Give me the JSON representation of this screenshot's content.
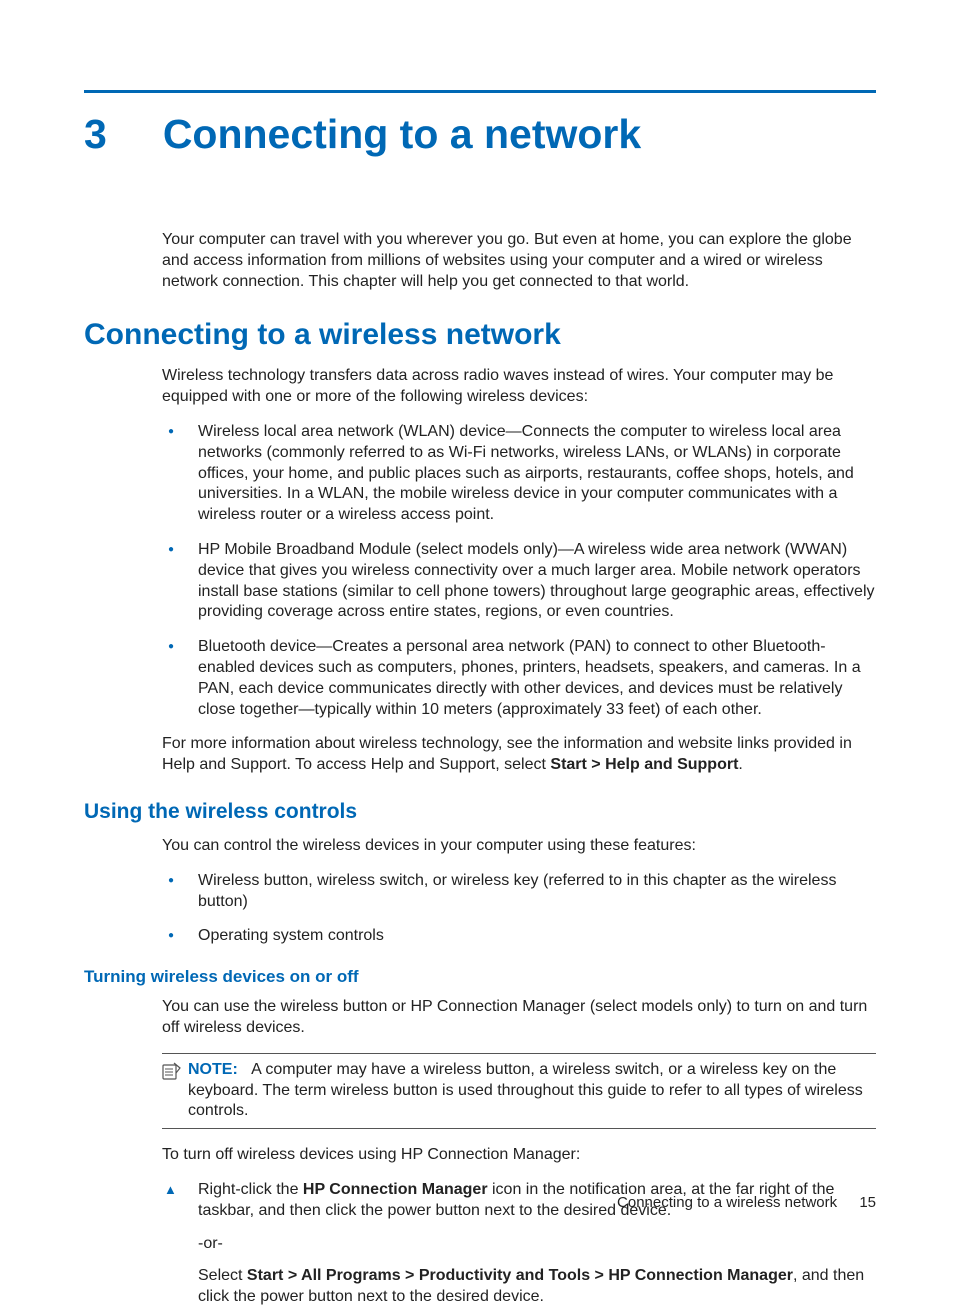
{
  "chapter": {
    "number": "3",
    "title": "Connecting to a network"
  },
  "intro": "Your computer can travel with you wherever you go. But even at home, you can explore the globe and access information from millions of websites using your computer and a wired or wireless network connection. This chapter will help you get connected to that world.",
  "section1": {
    "title": "Connecting to a wireless network",
    "intro": "Wireless technology transfers data across radio waves instead of wires. Your computer may be equipped with one or more of the following wireless devices:",
    "bullets": [
      "Wireless local area network (WLAN) device—Connects the computer to wireless local area networks (commonly referred to as Wi-Fi networks, wireless LANs, or WLANs) in corporate offices, your home, and public places such as airports, restaurants, coffee shops, hotels, and universities. In a WLAN, the mobile wireless device in your computer communicates with a wireless router or a wireless access point.",
      "HP Mobile Broadband Module (select models only)—A wireless wide area network (WWAN) device that gives you wireless connectivity over a much larger area. Mobile network operators install base stations (similar to cell phone towers) throughout large geographic areas, effectively providing coverage across entire states, regions, or even countries.",
      "Bluetooth device—Creates a personal area network (PAN) to connect to other Bluetooth-enabled devices such as computers, phones, printers, headsets, speakers, and cameras. In a PAN, each device communicates directly with other devices, and devices must be relatively close together—typically within 10 meters (approximately 33 feet) of each other."
    ],
    "tail_pre": "For more information about wireless technology, see the information and website links provided in Help and Support. To access Help and Support, select ",
    "tail_bold": "Start > Help and Support",
    "tail_post": "."
  },
  "sub1": {
    "title": "Using the wireless controls",
    "intro": "You can control the wireless devices in your computer using these features:",
    "bullets": [
      "Wireless button, wireless switch, or wireless key (referred to in this chapter as the wireless button)",
      "Operating system controls"
    ]
  },
  "sub2": {
    "title": "Turning wireless devices on or off",
    "intro": "You can use the wireless button or HP Connection Manager (select models only) to turn on and turn off wireless devices.",
    "note": {
      "label": "NOTE:",
      "text": "A computer may have a wireless button, a wireless switch, or a wireless key on the keyboard. The term wireless button is used throughout this guide to refer to all types of wireless controls."
    },
    "lead": "To turn off wireless devices using HP Connection Manager:",
    "proc": {
      "a_pre": "Right-click the ",
      "a_bold": "HP Connection Manager",
      "a_post": " icon in the notification area, at the far right of the taskbar, and then click the power button next to the desired device.",
      "or": "-or-",
      "b_pre": "Select ",
      "b_bold": "Start > All Programs > Productivity and Tools > HP Connection Manager",
      "b_post": ", and then click the power button next to the desired device."
    }
  },
  "footer": {
    "section": "Connecting to a wireless network",
    "page": "15"
  }
}
